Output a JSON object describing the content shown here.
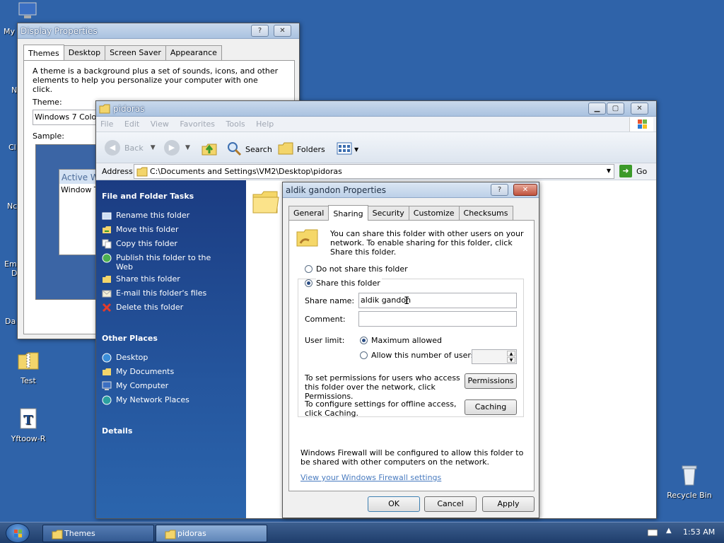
{
  "desktop": {
    "icons": [
      {
        "label": "Test"
      },
      {
        "label": "Yftoow-R"
      },
      {
        "label": "Recycle Bin"
      }
    ],
    "partial_labels": [
      "My",
      "N",
      "Cl",
      "Nc",
      "Em",
      "D",
      "Da"
    ]
  },
  "display_properties": {
    "title": "Display Properties",
    "tabs": [
      "Themes",
      "Desktop",
      "Screen Saver",
      "Appearance"
    ],
    "description": "A theme is a background plus a set of sounds, icons, and other elements to help you personalize your computer with one click.",
    "theme_label": "Theme:",
    "theme_value": "Windows 7 Colors",
    "sample_label": "Sample:",
    "sample_active": "Active W",
    "sample_window": "Window T"
  },
  "explorer": {
    "title": "pidoras",
    "menu": [
      "File",
      "Edit",
      "View",
      "Favorites",
      "Tools",
      "Help"
    ],
    "toolbar": {
      "back": "Back",
      "search": "Search",
      "folders": "Folders"
    },
    "address_label": "Address",
    "address_value": "C:\\Documents and Settings\\VM2\\Desktop\\pidoras",
    "go_label": "Go",
    "tasks_header": "File and Folder Tasks",
    "tasks": [
      "Rename this folder",
      "Move this folder",
      "Copy this folder",
      "Publish this folder to the Web",
      "Share this folder",
      "E-mail this folder's files",
      "Delete this folder"
    ],
    "places_header": "Other Places",
    "places": [
      "Desktop",
      "My Documents",
      "My Computer",
      "My Network Places"
    ],
    "details_header": "Details"
  },
  "properties": {
    "title": "aldik gandon Properties",
    "tabs": [
      "General",
      "Sharing",
      "Security",
      "Customize",
      "Checksums"
    ],
    "intro": "You can share this folder with other users on your network.  To enable sharing for this folder, click Share this folder.",
    "do_not_share": "Do not share this folder",
    "share": "Share this folder",
    "share_name_label": "Share name:",
    "share_name_value": "aldik gandon",
    "comment_label": "Comment:",
    "comment_value": "",
    "user_limit_label": "User limit:",
    "maximum_allowed": "Maximum allowed",
    "allow_number": "Allow this number of users:",
    "permissions_text": "To set permissions for users who access this folder over the network, click Permissions.",
    "permissions_button": "Permissions",
    "caching_text": "To configure settings for offline access, click Caching.",
    "caching_button": "Caching",
    "firewall_text": "Windows Firewall will be configured to allow this folder to be shared with other computers on the network.",
    "firewall_link": "View your Windows Firewall settings",
    "ok": "OK",
    "cancel": "Cancel",
    "apply": "Apply"
  },
  "taskbar": {
    "tasks": [
      "Themes",
      "pidoras"
    ],
    "clock": "1:53 AM"
  }
}
